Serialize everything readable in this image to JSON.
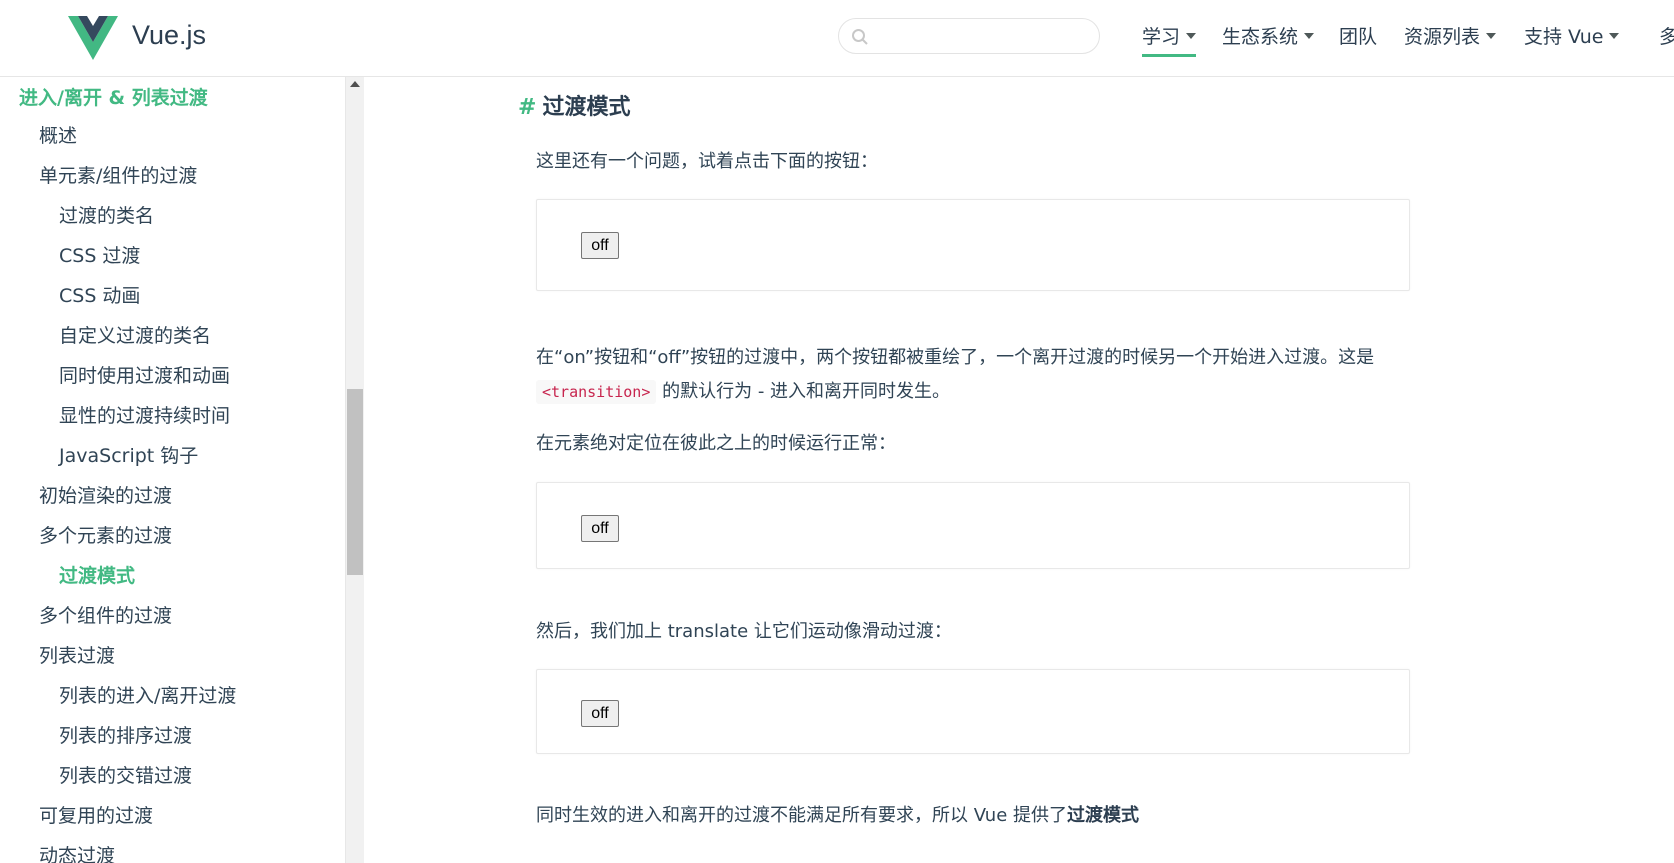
{
  "header": {
    "brand": "Vue.js",
    "search_placeholder": "",
    "nav": [
      {
        "label": "学习",
        "dropdown": true,
        "active": true
      },
      {
        "label": "生态系统",
        "dropdown": true
      },
      {
        "label": "团队",
        "dropdown": false
      },
      {
        "label": "资源列表",
        "dropdown": true
      },
      {
        "label": "支持 Vue",
        "dropdown": true
      },
      {
        "label": "多",
        "dropdown": false
      }
    ]
  },
  "sidebar": {
    "items": [
      {
        "label": "进入/离开 & 列表过渡",
        "level": 0,
        "active": true
      },
      {
        "label": "概述",
        "level": 1
      },
      {
        "label": "单元素/组件的过渡",
        "level": 1
      },
      {
        "label": "过渡的类名",
        "level": 2
      },
      {
        "label": "CSS 过渡",
        "level": 2
      },
      {
        "label": "CSS 动画",
        "level": 2
      },
      {
        "label": "自定义过渡的类名",
        "level": 2
      },
      {
        "label": "同时使用过渡和动画",
        "level": 2
      },
      {
        "label": "显性的过渡持续时间",
        "level": 2
      },
      {
        "label": "JavaScript 钩子",
        "level": 2
      },
      {
        "label": "初始渲染的过渡",
        "level": 1
      },
      {
        "label": "多个元素的过渡",
        "level": 1
      },
      {
        "label": "过渡模式",
        "level": 2,
        "active": true
      },
      {
        "label": "多个组件的过渡",
        "level": 1
      },
      {
        "label": "列表过渡",
        "level": 1
      },
      {
        "label": "列表的进入/离开过渡",
        "level": 2
      },
      {
        "label": "列表的排序过渡",
        "level": 2
      },
      {
        "label": "列表的交错过渡",
        "level": 2
      },
      {
        "label": "可复用的过渡",
        "level": 1
      },
      {
        "label": "动态过渡",
        "level": 1
      }
    ]
  },
  "content": {
    "heading_hash": "#",
    "heading": "过渡模式",
    "p1": "这里还有一个问题，试着点击下面的按钮：",
    "demo1_button": "off",
    "p2_before": "在“on”按钮和“off”按钮的过渡中，两个按钮都被重绘了，一个离开过渡的时候另一个开始进入过渡。这是",
    "p2_code": "<transition>",
    "p2_after": "的默认行为 - 进入和离开同时发生。",
    "p3": "在元素绝对定位在彼此之上的时候运行正常：",
    "demo2_button": "off",
    "p4": "然后，我们加上 translate 让它们运动像滑动过渡：",
    "demo3_button": "off",
    "p5_before": "同时生效的进入和离开的过渡不能满足所有要求，所以 Vue 提供了",
    "p5_bold": "过渡模式"
  },
  "colors": {
    "accent": "#42b983",
    "text": "#304455",
    "heading": "#2c3e50",
    "code": "#c7254e"
  }
}
